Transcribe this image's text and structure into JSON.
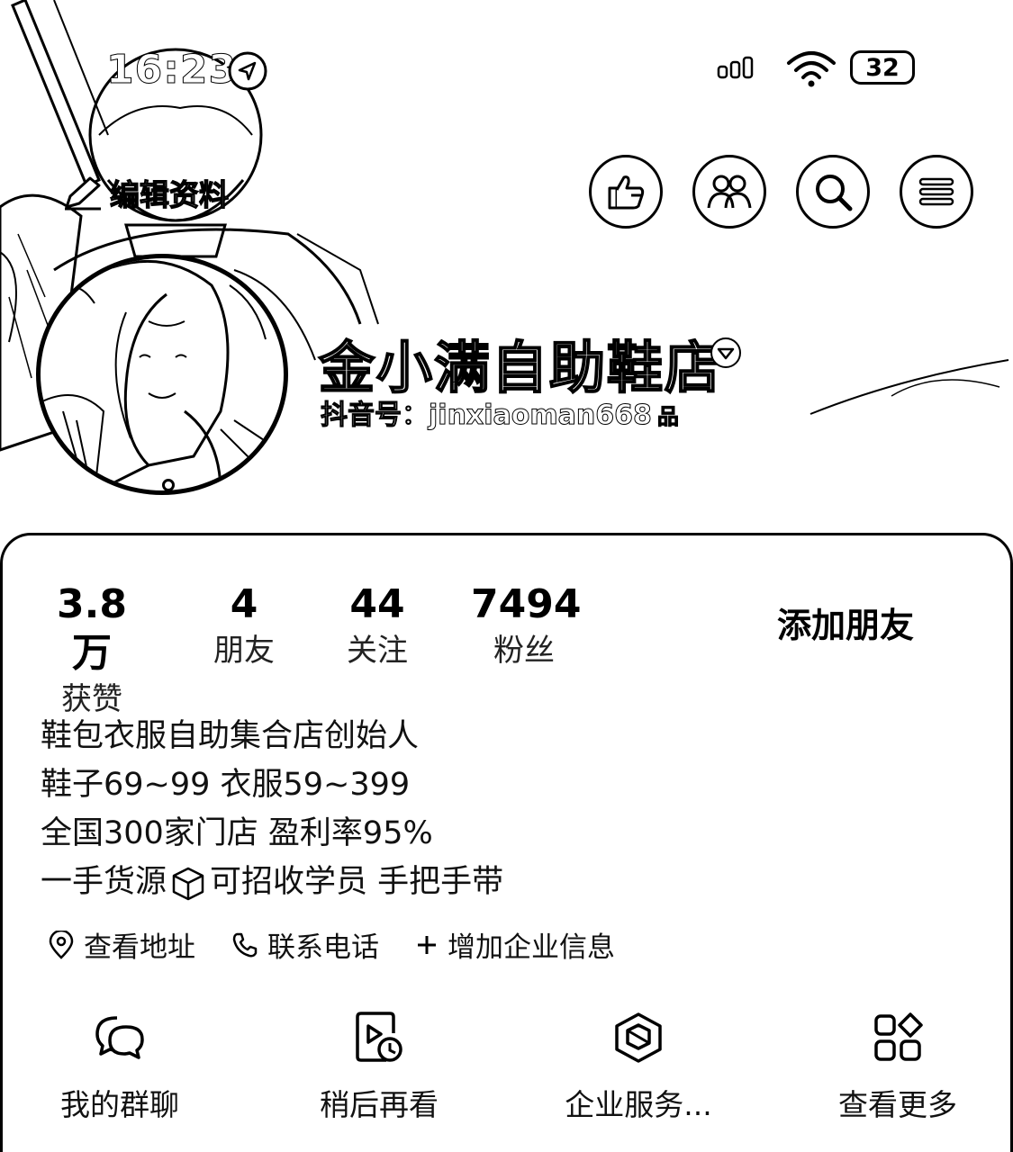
{
  "status_bar": {
    "time": "16:23",
    "battery": "32"
  },
  "header": {
    "edit_profile": "编辑资料",
    "actions": [
      {
        "name": "visitors",
        "icon": "share-hand-icon"
      },
      {
        "name": "friends",
        "icon": "people-icon"
      },
      {
        "name": "search",
        "icon": "search-icon"
      },
      {
        "name": "menu",
        "icon": "menu-icon"
      }
    ]
  },
  "profile": {
    "name": "金小满自助鞋店",
    "account_id": "抖音号：jinxiaoman668",
    "qr": "品"
  },
  "stats": [
    {
      "value": "3.8万",
      "label": "获赞"
    },
    {
      "value": "4",
      "label": "朋友"
    },
    {
      "value": "44",
      "label": "关注"
    },
    {
      "value": "7494",
      "label": "粉丝"
    }
  ],
  "add_friend": "添加朋友",
  "bio": {
    "line1": "鞋包衣服自助集合店创始人",
    "line2": "鞋子69~99 衣服59~399",
    "line3": "全国300家门店 盈利率95%",
    "line4a": "一手货源",
    "line4b": "可招收学员 手把手带"
  },
  "links": {
    "address": "查看地址",
    "phone": "联系电话",
    "enterprise": "增加企业信息"
  },
  "services": [
    {
      "label": "我的群聊",
      "icon": "group-chat-icon"
    },
    {
      "label": "稍后再看",
      "icon": "watch-later-icon"
    },
    {
      "label": "企业服务...",
      "icon": "enterprise-service-icon"
    },
    {
      "label": "查看更多",
      "icon": "more-apps-icon"
    }
  ]
}
